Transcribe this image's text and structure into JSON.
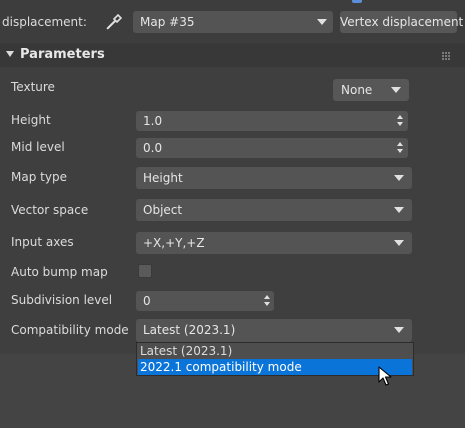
{
  "top": {
    "displacement_label": "displacement:",
    "map_value": "Map #35",
    "vertex_button": "Vertex displacement"
  },
  "panel": {
    "title": "Parameters",
    "texture": {
      "label": "Texture",
      "button": "None"
    },
    "height": {
      "label": "Height",
      "value": "1.0"
    },
    "mid_level": {
      "label": "Mid level",
      "value": "0.0"
    },
    "map_type": {
      "label": "Map type",
      "value": "Height"
    },
    "vector_space": {
      "label": "Vector space",
      "value": "Object"
    },
    "input_axes": {
      "label": "Input axes",
      "value": "+X,+Y,+Z"
    },
    "auto_bump": {
      "label": "Auto bump map",
      "checked": false
    },
    "subdivision": {
      "label": "Subdivision level",
      "value": "0"
    },
    "compat": {
      "label": "Compatibility mode",
      "value": "Latest (2023.1)",
      "options": [
        "Latest (2023.1)",
        "2022.1 compatibility mode"
      ],
      "highlighted_index": 1
    }
  },
  "colors": {
    "accent": "#0b74d9",
    "panel": "#3f3f3f",
    "field": "#545454"
  }
}
